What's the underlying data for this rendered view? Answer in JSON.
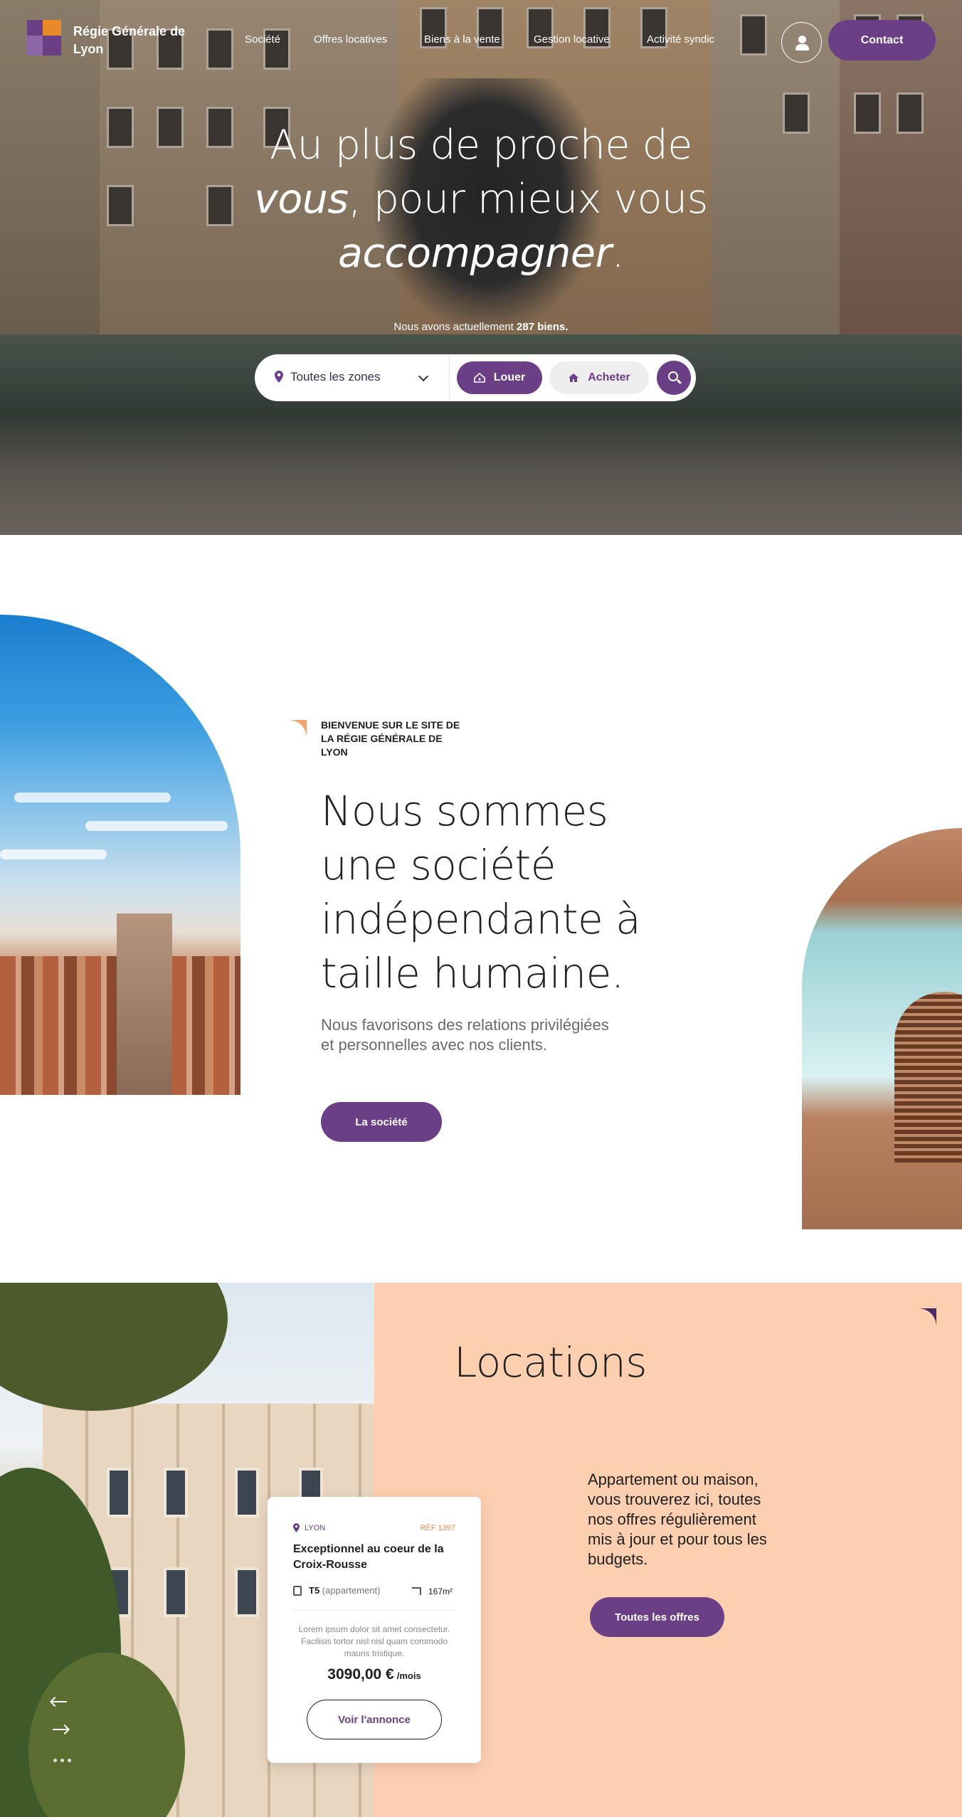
{
  "header": {
    "brand": "Régie Générale de Lyon",
    "nav": [
      "Société",
      "Offres locatives",
      "Biens à la vente",
      "Gestion locative",
      "Activité syndic"
    ],
    "contact_label": "Contact"
  },
  "hero": {
    "title_part1": "Au plus de proche de",
    "title_italic1": "vous",
    "title_part2": ", pour mieux vous",
    "title_italic2": "accompagner",
    "title_end": ".",
    "subtitle_prefix": "Nous avons actuellement",
    "subtitle_count": "287 biens."
  },
  "search": {
    "zone_value": "Toutes les zones",
    "rent_label": "Louer",
    "buy_label": "Acheter"
  },
  "intro": {
    "kicker": "Bienvenue sur le site de la Régie Générale de Lyon",
    "title": "Nous sommes une société indépendante à taille humaine.",
    "text": "Nous favorisons des relations privilégiées et personnelles avec nos clients.",
    "button": "La société"
  },
  "locations": {
    "title": "Locations",
    "text": "Appartement ou maison, vous trouverez ici, toutes nos offres régulièrement mis à jour et pour tous les budgets.",
    "button": "Toutes les offres",
    "card": {
      "city": "Lyon",
      "ref": "Réf 1397",
      "title": "Exceptionnel au coeur de la Croix-Rousse",
      "type": "T5",
      "type_detail": "(appartement)",
      "area": "167m²",
      "description": "Lorem ipsum dolor sit amet consectetur. Facilisis tortor nisl nisl quam commodo mauris tristique.",
      "price": "3090,00 €",
      "price_unit": "/mois",
      "button": "Voir l'annonce"
    }
  },
  "colors": {
    "primary": "#6a3f86",
    "accent": "#e98a2a",
    "peach": "#fdcfb1"
  }
}
